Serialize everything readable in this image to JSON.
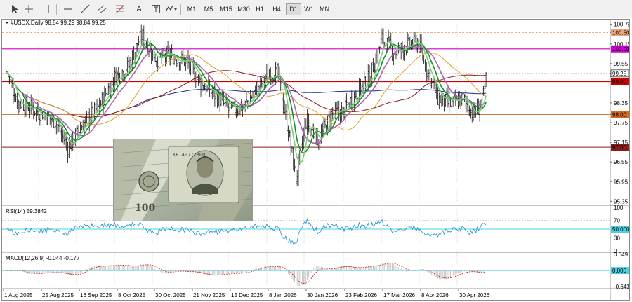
{
  "toolbar": {
    "tools": [
      {
        "name": "cursor-icon"
      },
      {
        "name": "crosshair-icon"
      },
      {
        "name": "vertical-line-icon"
      },
      {
        "name": "horizontal-line-icon"
      },
      {
        "name": "trendline-icon"
      },
      {
        "name": "channel-icon"
      },
      {
        "name": "fibonacci-icon"
      },
      {
        "name": "text-icon"
      },
      {
        "name": "text-label-icon"
      },
      {
        "name": "shapes-icon"
      }
    ],
    "text_tool_glyph": "A",
    "timeframes": [
      "M1",
      "M5",
      "M15",
      "M30",
      "H1",
      "H4",
      "D1",
      "W1",
      "MN"
    ],
    "active_timeframe": "D1"
  },
  "chart": {
    "symbol_line": "#USDX,Daily  98.84 99.29 98.84 99.25",
    "price_ticks": [
      "100.75",
      "100.50",
      "100.15",
      "99.55",
      "99.25",
      "99.00",
      "98.35",
      "98.00",
      "97.75",
      "97.15",
      "97.00",
      "96.55",
      "95.95",
      "95.35"
    ],
    "tick_values": [
      100.75,
      100.5,
      100.15,
      99.55,
      99.25,
      99.0,
      98.35,
      98.0,
      97.75,
      97.15,
      97.0,
      96.55,
      95.95,
      95.35
    ],
    "levels": [
      {
        "price": 100.5,
        "label": "100.50",
        "color": "#e8a87c",
        "style": "dash"
      },
      {
        "price": 100.0,
        "label": "100.00",
        "color": "#cc00cc",
        "style": "solid"
      },
      {
        "price": 99.25,
        "label": "99.25",
        "color": "#000000",
        "style": "current"
      },
      {
        "price": 99.0,
        "label": "99.00",
        "color": "#cc0000",
        "style": "solid"
      },
      {
        "price": 98.0,
        "label": "98.00",
        "color": "#d2691e",
        "style": "solid"
      },
      {
        "price": 97.0,
        "label": "97.00",
        "color": "#8b1a1a",
        "style": "solid"
      }
    ],
    "dates": [
      "1 Aug 2025",
      "25 Aug 2025",
      "16 Sep 2025",
      "8 Oct 2025",
      "30 Oct 2025",
      "21 Nov 2025",
      "15 Dec 2025",
      "8 Jan 2026",
      "30 Jan 2026",
      "23 Feb 2026",
      "17 Mar 2026",
      "8 Apr 2026",
      "30 Apr 2026"
    ]
  },
  "rsi": {
    "title": "RSI(14) 59.3842",
    "ticks": [
      "100",
      "70",
      "50.000",
      "30",
      "0"
    ],
    "current_label": "50.000"
  },
  "macd": {
    "title": "MACD(12,26,9) -0.044 -0.177",
    "ticks": [
      "0.649",
      "0.000",
      "-0.643"
    ],
    "current_label": "0.000"
  },
  "chart_data": {
    "type": "line",
    "title": "#USDX,Daily",
    "ohlc_last": {
      "open": 98.84,
      "high": 99.29,
      "low": 98.84,
      "close": 99.25
    },
    "x": [
      "1 Aug 2025",
      "25 Aug 2025",
      "16 Sep 2025",
      "8 Oct 2025",
      "30 Oct 2025",
      "21 Nov 2025",
      "15 Dec 2025",
      "8 Jan 2026",
      "30 Jan 2026",
      "23 Feb 2026",
      "17 Mar 2026",
      "8 Apr 2026",
      "30 Apr 2026"
    ],
    "series": [
      {
        "name": "#USDX",
        "values": [
          98.6,
          98.2,
          97.4,
          98.4,
          99.7,
          99.5,
          98.3,
          99.1,
          96.4,
          98.0,
          100.2,
          98.2,
          98.7
        ]
      }
    ],
    "ylim": [
      95.35,
      100.75
    ],
    "rsi_value": 59.3842,
    "macd": {
      "main": -0.044,
      "signal": -0.177
    }
  }
}
